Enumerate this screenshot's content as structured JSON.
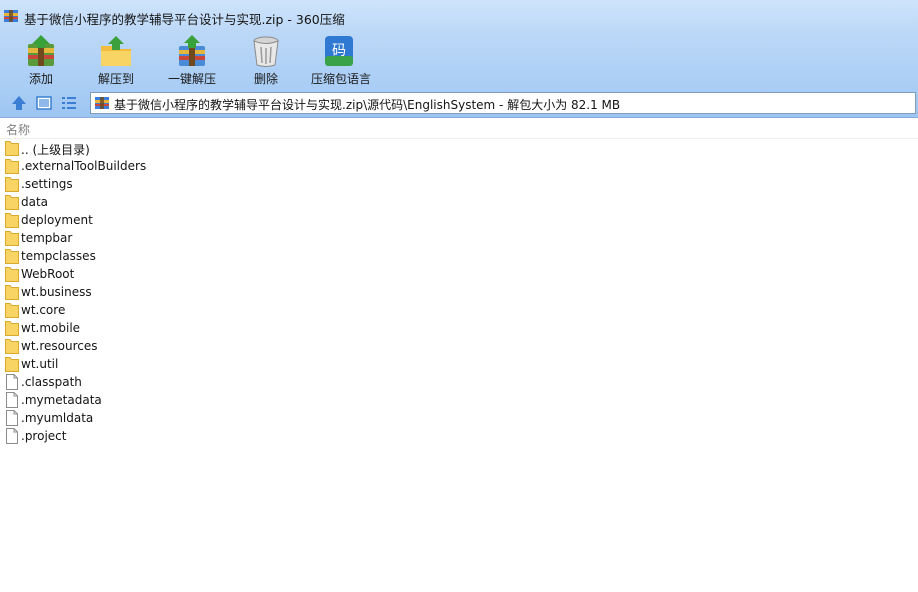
{
  "window": {
    "title": "基于微信小程序的教学辅导平台设计与实现.zip - 360压缩",
    "app_icon": "archive-icon"
  },
  "toolbar": {
    "buttons": [
      {
        "label": "添加",
        "icon": "add-archive-icon"
      },
      {
        "label": "解压到",
        "icon": "extract-to-icon"
      },
      {
        "label": "一键解压",
        "icon": "one-click-extract-icon"
      },
      {
        "label": "删除",
        "icon": "delete-bin-icon"
      },
      {
        "label": "压缩包语言",
        "icon": "archive-language-icon",
        "glyph": "码"
      }
    ]
  },
  "address": {
    "path": "基于微信小程序的教学辅导平台设计与实现.zip\\源代码\\EnglishSystem - 解包大小为 82.1 MB"
  },
  "list": {
    "column_name": "名称",
    "items": [
      {
        "name": ".. (上级目录)",
        "type": "folder"
      },
      {
        "name": ".externalToolBuilders",
        "type": "folder"
      },
      {
        "name": ".settings",
        "type": "folder"
      },
      {
        "name": "data",
        "type": "folder"
      },
      {
        "name": "deployment",
        "type": "folder"
      },
      {
        "name": "tempbar",
        "type": "folder"
      },
      {
        "name": "tempclasses",
        "type": "folder"
      },
      {
        "name": "WebRoot",
        "type": "folder"
      },
      {
        "name": "wt.business",
        "type": "folder"
      },
      {
        "name": "wt.core",
        "type": "folder"
      },
      {
        "name": "wt.mobile",
        "type": "folder"
      },
      {
        "name": "wt.resources",
        "type": "folder"
      },
      {
        "name": "wt.util",
        "type": "folder"
      },
      {
        "name": ".classpath",
        "type": "file"
      },
      {
        "name": ".mymetadata",
        "type": "file"
      },
      {
        "name": ".myumldata",
        "type": "file"
      },
      {
        "name": ".project",
        "type": "file"
      }
    ]
  },
  "colors": {
    "folder": "#f7d463",
    "folder_edge": "#d9a92e",
    "accent_blue": "#3a7fd4",
    "titlebar": "#cfe4fb"
  }
}
